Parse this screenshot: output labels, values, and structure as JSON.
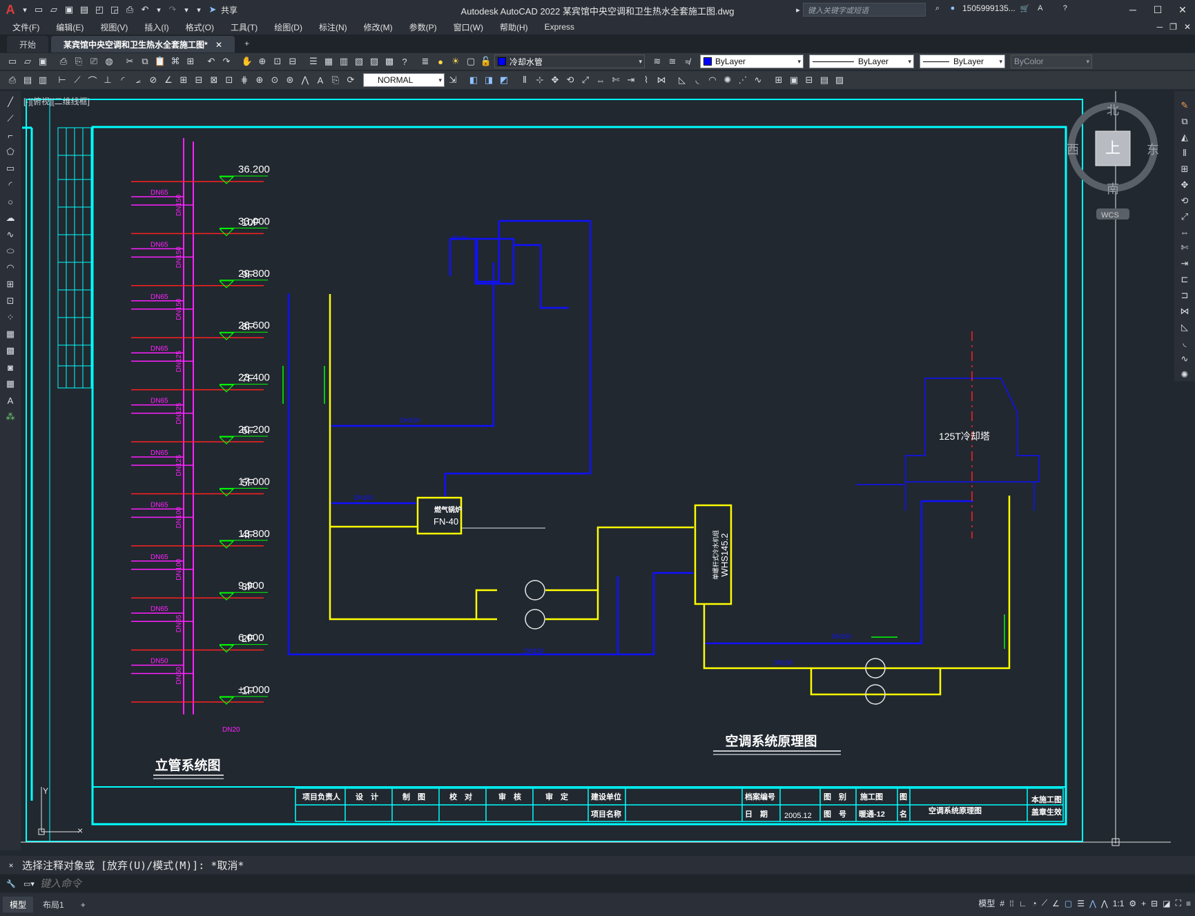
{
  "app": {
    "logo": "A",
    "title": "Autodesk AutoCAD 2022    某宾馆中央空调和卫生热水全套施工图.dwg",
    "share_label": "共享",
    "search_placeholder": "键入关键字或短语",
    "user_name": "1505999135...",
    "window_buttons": [
      "─",
      "☐",
      "✕"
    ]
  },
  "menu": [
    "文件(F)",
    "编辑(E)",
    "视图(V)",
    "插入(I)",
    "格式(O)",
    "工具(T)",
    "绘图(D)",
    "标注(N)",
    "修改(M)",
    "参数(P)",
    "窗口(W)",
    "帮助(H)",
    "Express"
  ],
  "tabs": [
    {
      "label": "开始",
      "active": false
    },
    {
      "label": "某宾馆中央空调和卫生热水全套施工图*",
      "active": true
    }
  ],
  "properties": {
    "layer_name": "冷却水管",
    "color": "ByLayer",
    "linetype": "ByLayer",
    "lineweight": "ByLayer",
    "plotstyle": "ByColor",
    "dimstyle": "NORMAL"
  },
  "viewport": {
    "label": "[-][俯视][二维线框]"
  },
  "viewcube": {
    "north": "北",
    "south": "南",
    "east": "东",
    "west": "西",
    "top": "上",
    "wcs": "WCS"
  },
  "drawing": {
    "riser_title": "立管系统图",
    "schematic_title": "空调系统原理图",
    "elevations": [
      "36.200",
      "33.000",
      "29.800",
      "26.600",
      "23.400",
      "20.200",
      "17.000",
      "13.800",
      "9.900",
      "6.000",
      "±0.000"
    ],
    "floors": [
      "10F",
      "9F",
      "8F",
      "7F",
      "6F",
      "5F",
      "4F",
      "3F",
      "2F",
      "1F"
    ],
    "riser_sizes": [
      "DN150",
      "DN150",
      "DN150",
      "DN125",
      "DN125",
      "DN125",
      "DN100",
      "DN100",
      "DN65",
      "DN50"
    ],
    "branch_size": "DN65",
    "branch_size_low": "DN50",
    "riser_bottom": "DN20",
    "boiler_name": "燃气锅炉",
    "boiler_model": "FN-40",
    "chiller_name": "单螺杆式冷水机组",
    "chiller_model": "WHS145.2",
    "tower_label": "125T冷却塔",
    "pipe_dn150": "DN150",
    "pipe_dn100": "DN100",
    "pipe_dn50": "DN50",
    "pipe_dn40": "DN40"
  },
  "titleblock": {
    "cells": [
      "项目负责人",
      "设　计",
      "制　图",
      "校　对",
      "审　核",
      "审　定",
      "建设单位",
      "项目名称",
      "档案编号",
      "日　期",
      "2005.12",
      "图　别",
      "施工图",
      "图　号",
      "暖通-12",
      "图",
      "名",
      "空调系统原理图",
      "本施工图",
      "盖章生效"
    ]
  },
  "command": {
    "history": "选择注释对象或 [放弃(U)/模式(M)]: *取消*",
    "placeholder": "键入命令"
  },
  "status": {
    "layout_tabs": [
      "模型",
      "布局1"
    ],
    "model_label": "模型",
    "scale": "1:1"
  }
}
